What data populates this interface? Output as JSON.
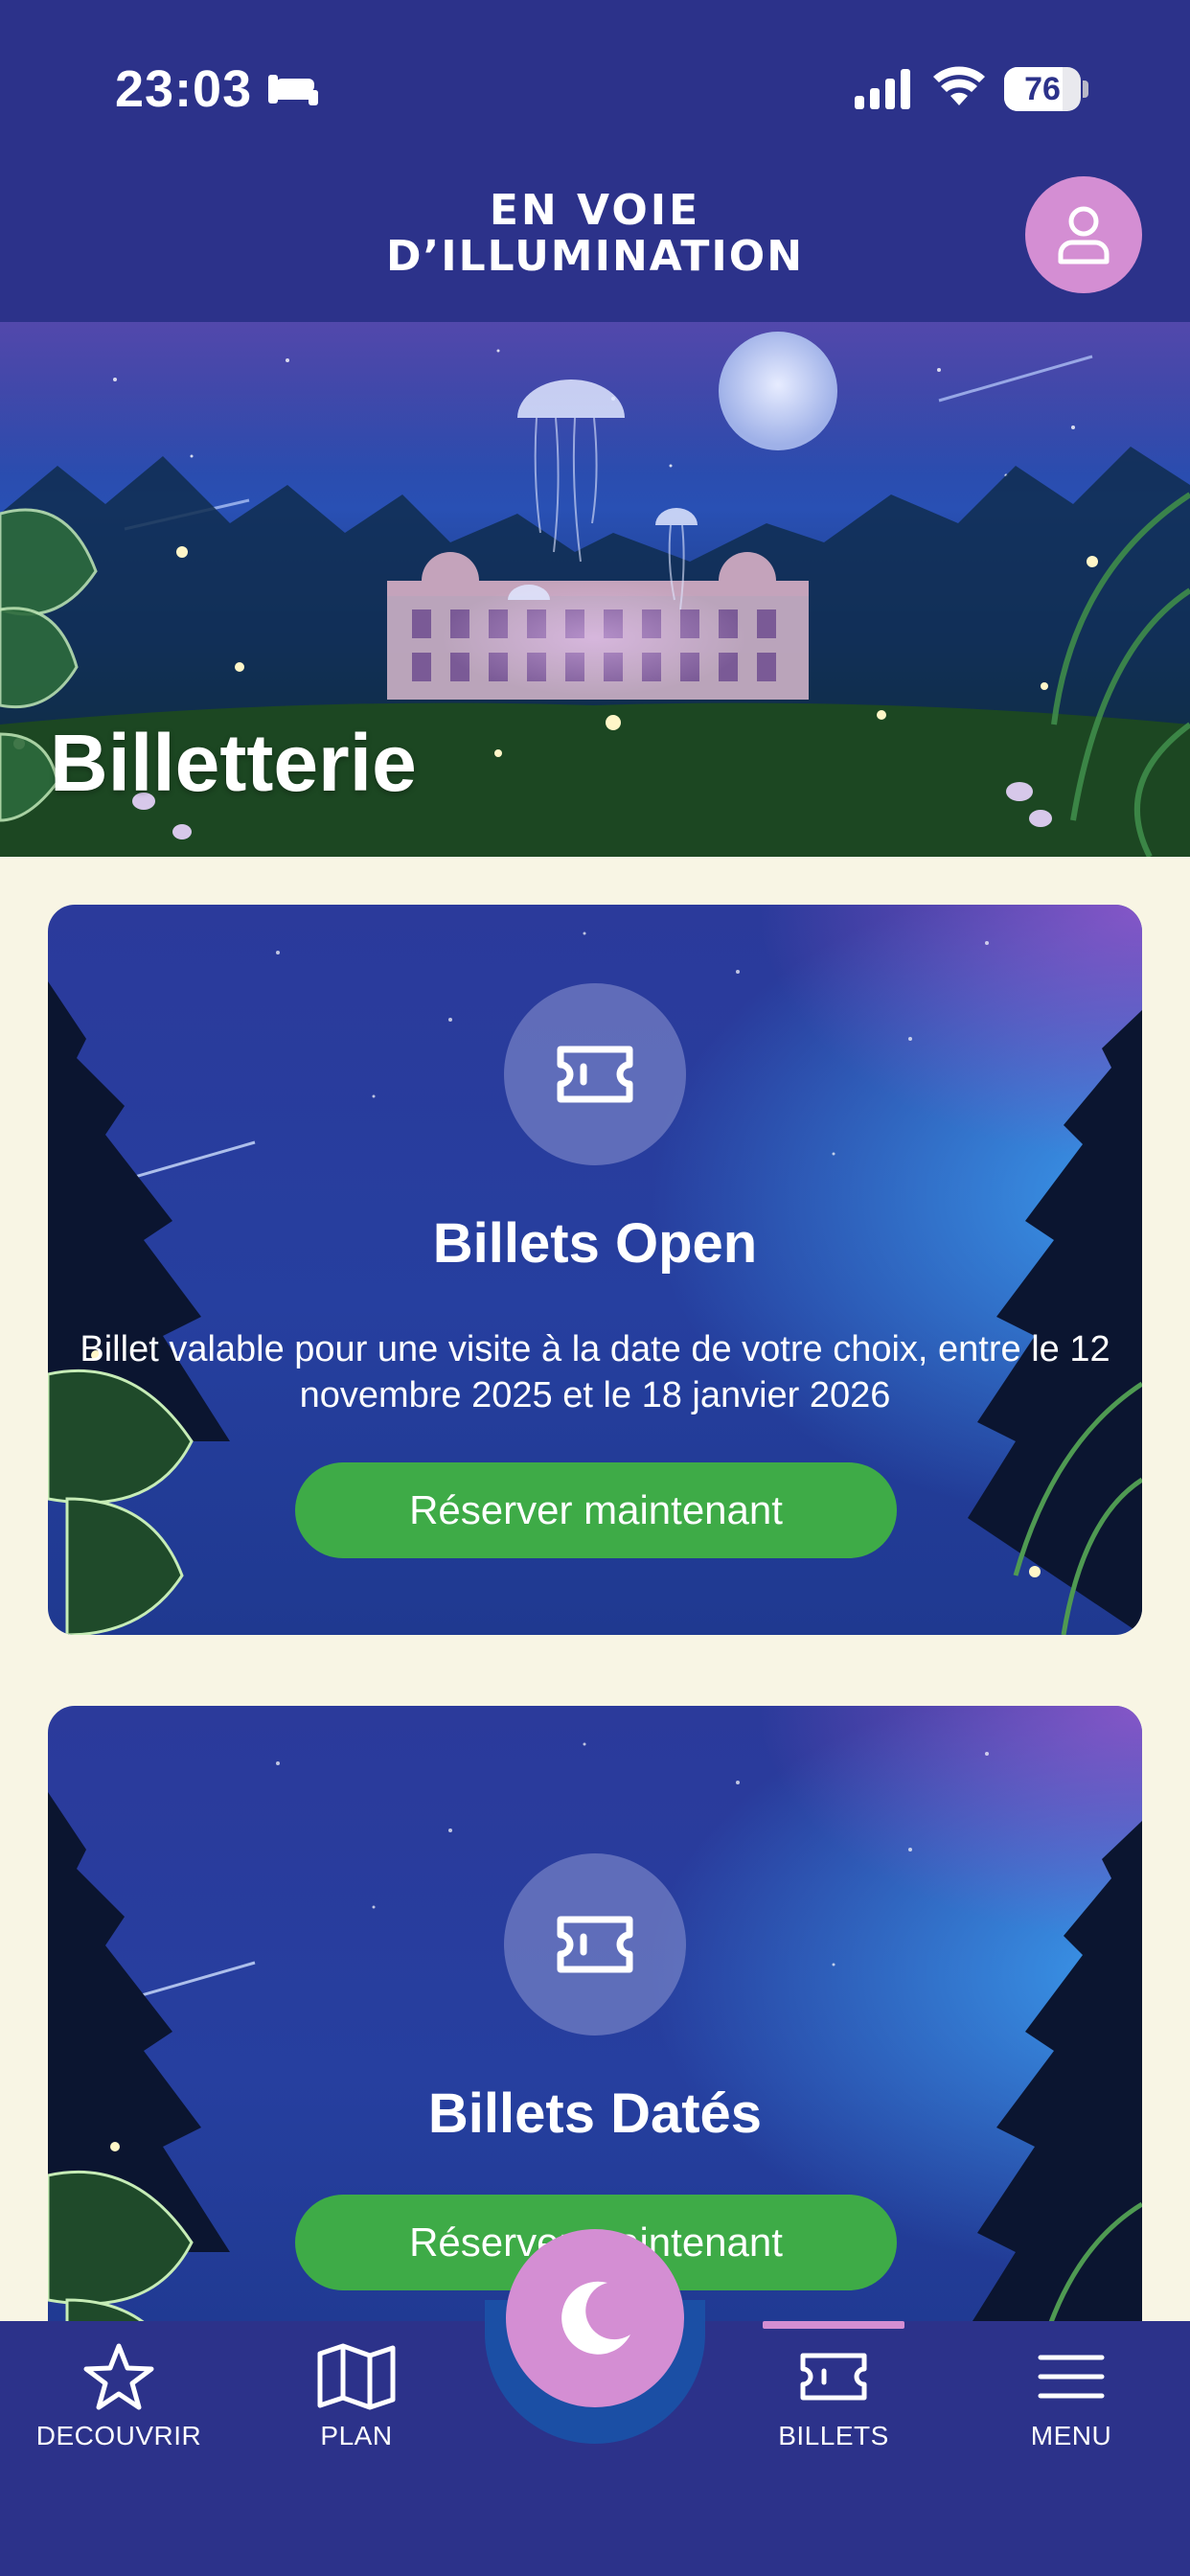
{
  "status_bar": {
    "time": "23:03",
    "battery_level": "76",
    "icons": [
      "bed-icon",
      "cellular-signal-icon",
      "wifi-icon",
      "battery-icon"
    ]
  },
  "header": {
    "logo_line1": "EN VOIE",
    "logo_line2": "D’ILLUMINATION",
    "profile_icon": "user-icon"
  },
  "hero": {
    "title": "Billetterie"
  },
  "cards": [
    {
      "icon": "ticket-icon",
      "title": "Billets Open",
      "description": "Billet valable pour une visite à la date de votre choix, entre le 12 novembre 2025 et le 18 janvier 2026",
      "cta": "Réserver maintenant"
    },
    {
      "icon": "ticket-icon",
      "title": "Billets Datés",
      "cta": "Réserver maintenant"
    }
  ],
  "bottom_nav": {
    "items": [
      {
        "label": "DECOUVRIR",
        "icon": "star-icon"
      },
      {
        "label": "PLAN",
        "icon": "map-icon"
      },
      {
        "label": "BILLETS",
        "icon": "ticket-icon",
        "active": true
      },
      {
        "label": "MENU",
        "icon": "hamburger-menu-icon"
      }
    ],
    "center_icon": "moon-icon"
  },
  "colors": {
    "navy": "#2c328a",
    "pink": "#d48ed3",
    "green": "#3eab47",
    "cream": "#f8f5e4"
  }
}
